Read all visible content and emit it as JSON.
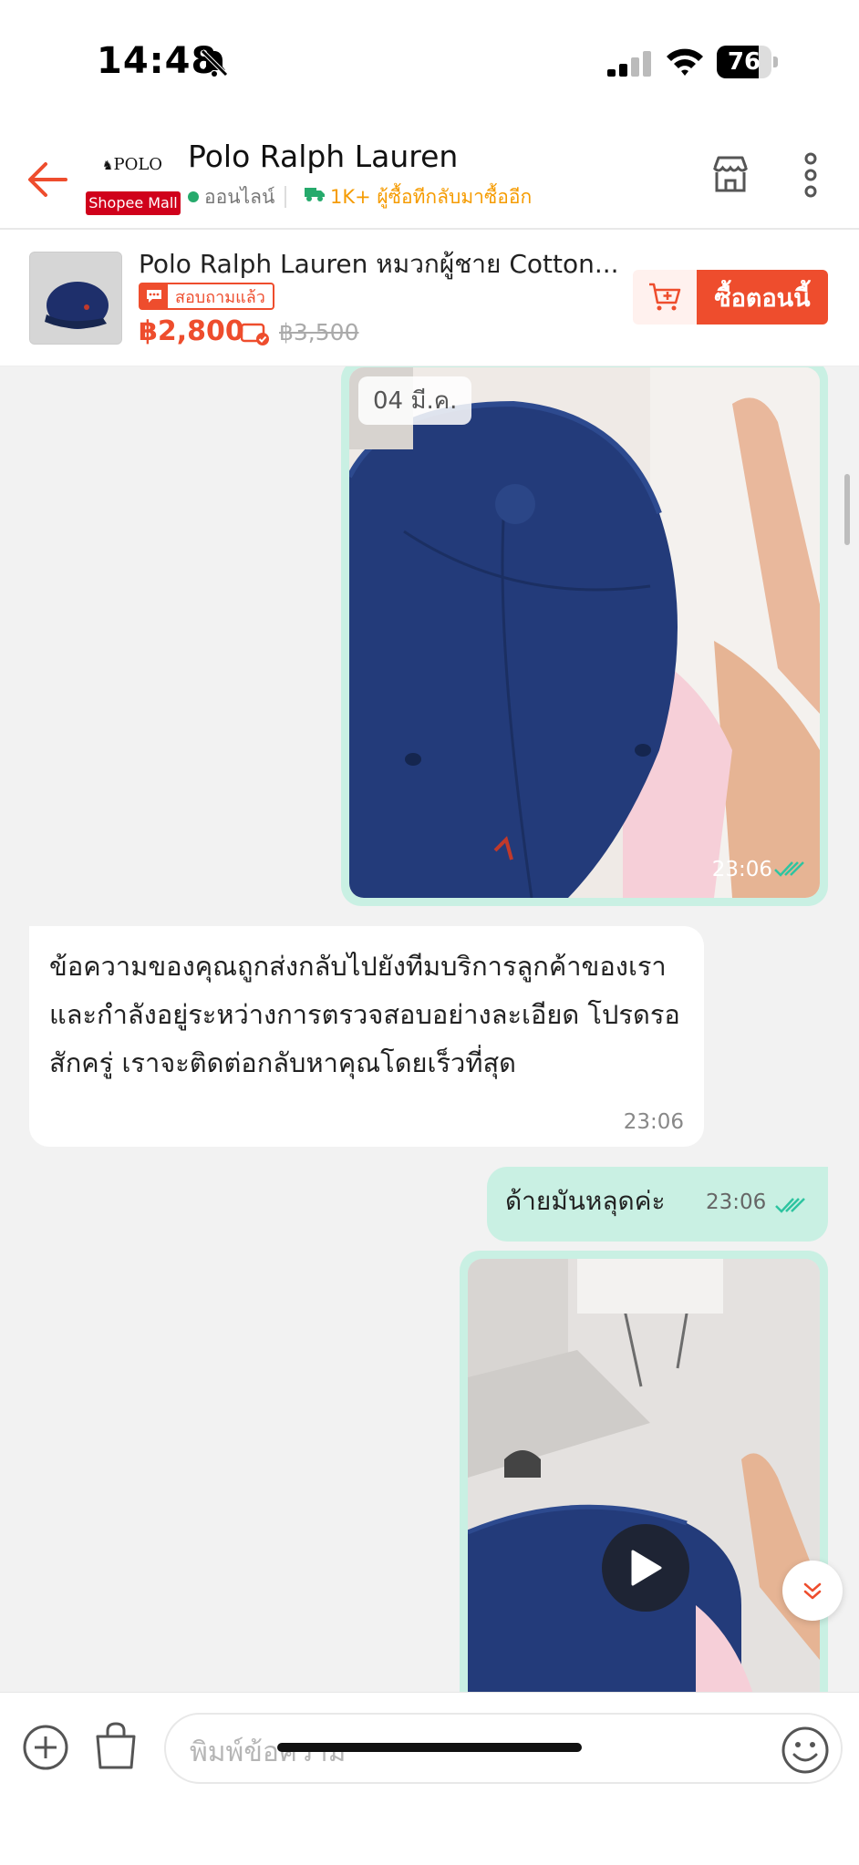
{
  "status_bar": {
    "time": "14:48",
    "battery": "76",
    "battery_level": 0.76
  },
  "header": {
    "shop_name": "Polo Ralph Lauren",
    "logo_text": "POLO",
    "mall_badge": "Shopee Mall",
    "online_status": "ออนไลน์",
    "repeat_buyers": "1K+ ผู้ซื้อทีกลับมาซื้ออีก"
  },
  "product": {
    "title": "Polo Ralph Lauren หมวกผู้ชาย Cotton...",
    "asked_badge": "สอบถามแล้ว",
    "price": "฿2,800",
    "original_price": "฿3,500",
    "buy_now": "ซื้อตอนนี้"
  },
  "chat": {
    "date_chip": "04 มี.ค.",
    "image_msg_1_time": "23:06",
    "bot_message": "ข้อความของคุณถูกส่งกลับไปยังทีมบริการลูกค้าของเราและกำลังอยู่ระหว่างการตรวจสอบอย่างละเอียด โปรดรอสักครู่ เราจะติดต่อกลับหาคุณโดยเร็วที่สุด",
    "bot_message_time": "23:06",
    "user_message": "ด้ายมันหลุดค่ะ",
    "user_message_time": "23:06"
  },
  "input": {
    "placeholder": "พิมพ์ข้อความ"
  },
  "colors": {
    "accent": "#ee4d2d",
    "bubble": "#c9f0e3",
    "online": "#26aa6c",
    "repeat": "#f59b00"
  }
}
